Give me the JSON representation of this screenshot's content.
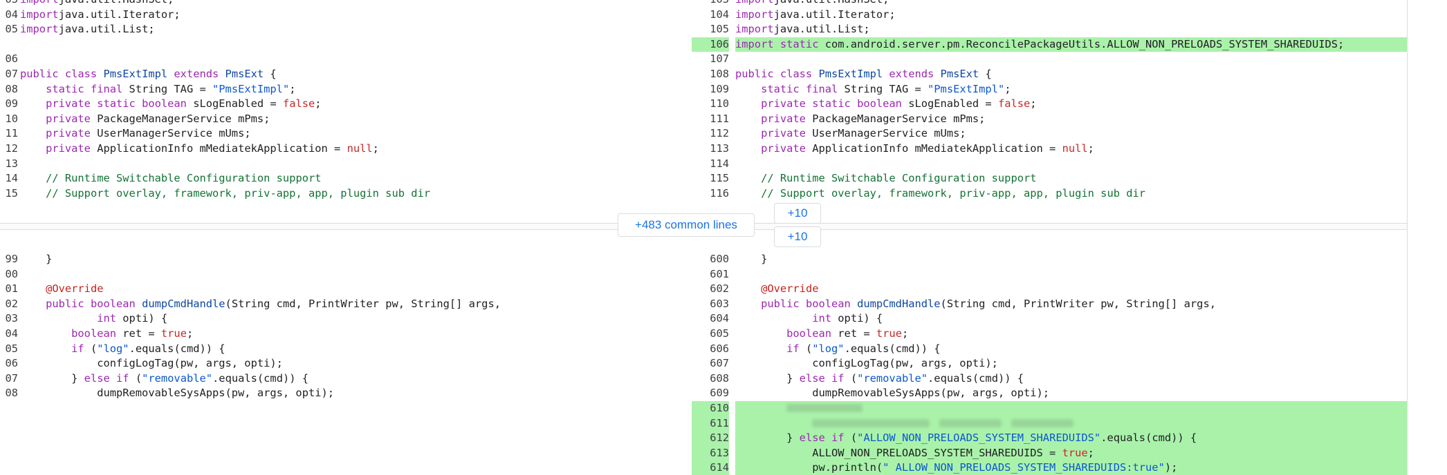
{
  "common": {
    "label": "+483 common lines",
    "expand_up": "+10",
    "expand_down": "+10"
  },
  "left": {
    "top": [
      {
        "num": "03",
        "tokens": [
          [
            "kw",
            "import"
          ],
          [
            "",
            "java.util.HashSet;"
          ]
        ]
      },
      {
        "num": "04",
        "tokens": [
          [
            "kw",
            "import"
          ],
          [
            "",
            "java.util.Iterator;"
          ]
        ]
      },
      {
        "num": "05",
        "tokens": [
          [
            "kw",
            "import"
          ],
          [
            "",
            "java.util.List;"
          ]
        ]
      },
      {
        "num": "",
        "empty": true,
        "tokens": []
      },
      {
        "num": "06",
        "tokens": []
      },
      {
        "num": "07",
        "tokens": [
          [
            "kw",
            "public class "
          ],
          [
            "ty",
            "PmsExtImpl"
          ],
          [
            "kw",
            " extends "
          ],
          [
            "ty",
            "PmsExt"
          ],
          [
            "",
            " {"
          ]
        ]
      },
      {
        "num": "08",
        "tokens": [
          [
            "",
            "    "
          ],
          [
            "kw",
            "static final "
          ],
          [
            "",
            "String TAG = "
          ],
          [
            "str",
            "\"PmsExtImpl\""
          ],
          [
            "",
            ";"
          ]
        ]
      },
      {
        "num": "09",
        "tokens": [
          [
            "",
            "    "
          ],
          [
            "kw",
            "private static boolean "
          ],
          [
            "",
            "sLogEnabled = "
          ],
          [
            "lit",
            "false"
          ],
          [
            "",
            ";"
          ]
        ]
      },
      {
        "num": "10",
        "tokens": [
          [
            "",
            "    "
          ],
          [
            "kw",
            "private "
          ],
          [
            "",
            "PackageManagerService mPms;"
          ]
        ]
      },
      {
        "num": "11",
        "tokens": [
          [
            "",
            "    "
          ],
          [
            "kw",
            "private "
          ],
          [
            "",
            "UserManagerService mUms;"
          ]
        ]
      },
      {
        "num": "12",
        "tokens": [
          [
            "",
            "    "
          ],
          [
            "kw",
            "private "
          ],
          [
            "",
            "ApplicationInfo mMediatekApplication = "
          ],
          [
            "lit",
            "null"
          ],
          [
            "",
            ";"
          ]
        ]
      },
      {
        "num": "13",
        "tokens": []
      },
      {
        "num": "14",
        "tokens": [
          [
            "",
            "    "
          ],
          [
            "cmt",
            "// Runtime Switchable Configuration support"
          ]
        ]
      },
      {
        "num": "15",
        "tokens": [
          [
            "",
            "    "
          ],
          [
            "cmt",
            "// Support overlay, framework, priv-app, app, plugin sub dir"
          ]
        ]
      }
    ],
    "bottom": [
      {
        "num": "99",
        "tokens": [
          [
            "",
            "    }"
          ]
        ]
      },
      {
        "num": "00",
        "tokens": []
      },
      {
        "num": "01",
        "tokens": [
          [
            "",
            "    "
          ],
          [
            "ann",
            "@Override"
          ]
        ]
      },
      {
        "num": "02",
        "tokens": [
          [
            "",
            "    "
          ],
          [
            "kw",
            "public boolean "
          ],
          [
            "fn",
            "dumpCmdHandle"
          ],
          [
            "",
            "(String cmd, PrintWriter pw, String[] args,"
          ]
        ]
      },
      {
        "num": "03",
        "tokens": [
          [
            "",
            "            "
          ],
          [
            "kw",
            "int "
          ],
          [
            "",
            "opti) {"
          ]
        ]
      },
      {
        "num": "04",
        "tokens": [
          [
            "",
            "        "
          ],
          [
            "kw",
            "boolean "
          ],
          [
            "",
            "ret = "
          ],
          [
            "lit",
            "true"
          ],
          [
            "",
            ";"
          ]
        ]
      },
      {
        "num": "05",
        "tokens": [
          [
            "",
            "        "
          ],
          [
            "kw",
            "if "
          ],
          [
            "",
            "("
          ],
          [
            "str",
            "\"log\""
          ],
          [
            "",
            ".equals(cmd)) {"
          ]
        ]
      },
      {
        "num": "06",
        "tokens": [
          [
            "",
            "            configLogTag(pw, args, opti);"
          ]
        ]
      },
      {
        "num": "07",
        "tokens": [
          [
            "",
            "        } "
          ],
          [
            "kw",
            "else if "
          ],
          [
            "",
            "("
          ],
          [
            "str",
            "\"removable\""
          ],
          [
            "",
            ".equals(cmd)) {"
          ]
        ]
      },
      {
        "num": "08",
        "tokens": [
          [
            "",
            "            dumpRemovableSysApps(pw, args, opti);"
          ]
        ]
      },
      {
        "num": "",
        "empty": true,
        "tokens": []
      },
      {
        "num": "",
        "empty": true,
        "tokens": []
      },
      {
        "num": "",
        "empty": true,
        "tokens": []
      },
      {
        "num": "",
        "empty": true,
        "tokens": []
      },
      {
        "num": "",
        "empty": true,
        "tokens": []
      }
    ]
  },
  "right": {
    "top": [
      {
        "num": "103",
        "tokens": [
          [
            "kw",
            "import"
          ],
          [
            "",
            "java.util.HashSet;"
          ]
        ]
      },
      {
        "num": "104",
        "tokens": [
          [
            "kw",
            "import"
          ],
          [
            "",
            "java.util.Iterator;"
          ]
        ]
      },
      {
        "num": "105",
        "tokens": [
          [
            "kw",
            "import"
          ],
          [
            "",
            "java.util.List;"
          ]
        ]
      },
      {
        "num": "106",
        "added": true,
        "tokens": [
          [
            "kw",
            "import static "
          ],
          [
            "",
            "com.android.server.pm.ReconcilePackageUtils.ALLOW_NON_PRELOADS_SYSTEM_SHAREDUIDS;"
          ]
        ]
      },
      {
        "num": "107",
        "tokens": []
      },
      {
        "num": "108",
        "tokens": [
          [
            "kw",
            "public class "
          ],
          [
            "ty",
            "PmsExtImpl"
          ],
          [
            "kw",
            " extends "
          ],
          [
            "ty",
            "PmsExt"
          ],
          [
            "",
            " {"
          ]
        ]
      },
      {
        "num": "109",
        "tokens": [
          [
            "",
            "    "
          ],
          [
            "kw",
            "static final "
          ],
          [
            "",
            "String TAG = "
          ],
          [
            "str",
            "\"PmsExtImpl\""
          ],
          [
            "",
            ";"
          ]
        ]
      },
      {
        "num": "110",
        "tokens": [
          [
            "",
            "    "
          ],
          [
            "kw",
            "private static boolean "
          ],
          [
            "",
            "sLogEnabled = "
          ],
          [
            "lit",
            "false"
          ],
          [
            "",
            ";"
          ]
        ]
      },
      {
        "num": "111",
        "tokens": [
          [
            "",
            "    "
          ],
          [
            "kw",
            "private "
          ],
          [
            "",
            "PackageManagerService mPms;"
          ]
        ]
      },
      {
        "num": "112",
        "tokens": [
          [
            "",
            "    "
          ],
          [
            "kw",
            "private "
          ],
          [
            "",
            "UserManagerService mUms;"
          ]
        ]
      },
      {
        "num": "113",
        "tokens": [
          [
            "",
            "    "
          ],
          [
            "kw",
            "private "
          ],
          [
            "",
            "ApplicationInfo mMediatekApplication = "
          ],
          [
            "lit",
            "null"
          ],
          [
            "",
            ";"
          ]
        ]
      },
      {
        "num": "114",
        "tokens": []
      },
      {
        "num": "115",
        "tokens": [
          [
            "",
            "    "
          ],
          [
            "cmt",
            "// Runtime Switchable Configuration support"
          ]
        ]
      },
      {
        "num": "116",
        "tokens": [
          [
            "",
            "    "
          ],
          [
            "cmt",
            "// Support overlay, framework, priv-app, app, plugin sub dir"
          ]
        ]
      }
    ],
    "bottom": [
      {
        "num": "600",
        "tokens": [
          [
            "",
            "    }"
          ]
        ]
      },
      {
        "num": "601",
        "tokens": []
      },
      {
        "num": "602",
        "tokens": [
          [
            "",
            "    "
          ],
          [
            "ann",
            "@Override"
          ]
        ]
      },
      {
        "num": "603",
        "tokens": [
          [
            "",
            "    "
          ],
          [
            "kw",
            "public boolean "
          ],
          [
            "fn",
            "dumpCmdHandle"
          ],
          [
            "",
            "(String cmd, PrintWriter pw, String[] args,"
          ]
        ]
      },
      {
        "num": "604",
        "tokens": [
          [
            "",
            "            "
          ],
          [
            "kw",
            "int "
          ],
          [
            "",
            "opti) {"
          ]
        ]
      },
      {
        "num": "605",
        "tokens": [
          [
            "",
            "        "
          ],
          [
            "kw",
            "boolean "
          ],
          [
            "",
            "ret = "
          ],
          [
            "lit",
            "true"
          ],
          [
            "",
            ";"
          ]
        ]
      },
      {
        "num": "606",
        "tokens": [
          [
            "",
            "        "
          ],
          [
            "kw",
            "if "
          ],
          [
            "",
            "("
          ],
          [
            "str",
            "\"log\""
          ],
          [
            "",
            ".equals(cmd)) {"
          ]
        ]
      },
      {
        "num": "607",
        "tokens": [
          [
            "",
            "            configLogTag(pw, args, opti);"
          ]
        ]
      },
      {
        "num": "608",
        "tokens": [
          [
            "",
            "        } "
          ],
          [
            "kw",
            "else if "
          ],
          [
            "",
            "("
          ],
          [
            "str",
            "\"removable\""
          ],
          [
            "",
            ".equals(cmd)) {"
          ]
        ]
      },
      {
        "num": "609",
        "tokens": [
          [
            "",
            "            dumpRemovableSysApps(pw, args, opti);"
          ]
        ]
      },
      {
        "num": "610",
        "added": true,
        "blur": 1,
        "tokens": []
      },
      {
        "num": "611",
        "added": true,
        "blur": 2,
        "tokens": []
      },
      {
        "num": "612",
        "added": true,
        "tokens": [
          [
            "",
            "        } "
          ],
          [
            "kw",
            "else if "
          ],
          [
            "",
            "("
          ],
          [
            "str",
            "\"ALLOW_NON_PRELOADS_SYSTEM_SHAREDUIDS\""
          ],
          [
            "",
            ".equals(cmd)) {"
          ]
        ]
      },
      {
        "num": "613",
        "added": true,
        "tokens": [
          [
            "",
            "            ALLOW_NON_PRELOADS_SYSTEM_SHAREDUIDS = "
          ],
          [
            "lit",
            "true"
          ],
          [
            "",
            ";"
          ]
        ]
      },
      {
        "num": "614",
        "added": true,
        "tokens": [
          [
            "",
            "            pw.println("
          ],
          [
            "str",
            "\" ALLOW_NON_PRELOADS_SYSTEM_SHAREDUIDS:true\""
          ],
          [
            "",
            ");"
          ]
        ]
      }
    ]
  }
}
